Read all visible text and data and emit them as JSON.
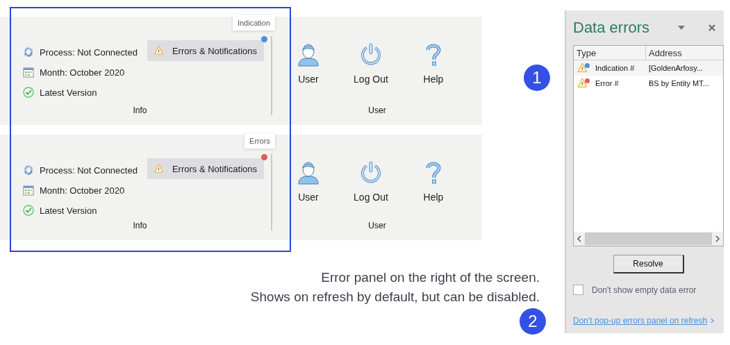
{
  "ribbons": [
    {
      "tooltip": "Indication",
      "color": "#4a90e2",
      "info_lines": [
        {
          "kind": "process",
          "text": "Process: Not Connected"
        },
        {
          "kind": "month",
          "text": "Month: October 2020"
        },
        {
          "kind": "version",
          "text": "Latest Version"
        }
      ],
      "errors_button": "Errors & Notifications",
      "info_group": "Info",
      "user_buttons": [
        {
          "kind": "user",
          "label": "User"
        },
        {
          "kind": "logout",
          "label": "Log Out"
        },
        {
          "kind": "help",
          "label": "Help"
        }
      ],
      "user_group": "User"
    },
    {
      "tooltip": "Errors",
      "color": "#e05a5a",
      "info_lines": [
        {
          "kind": "process",
          "text": "Process: Not Connected"
        },
        {
          "kind": "month",
          "text": "Month: October 2020"
        },
        {
          "kind": "version",
          "text": "Latest Version"
        }
      ],
      "errors_button": "Errors & Notifications",
      "info_group": "Info",
      "user_buttons": [
        {
          "kind": "user",
          "label": "User"
        },
        {
          "kind": "logout",
          "label": "Log Out"
        },
        {
          "kind": "help",
          "label": "Help"
        }
      ],
      "user_group": "User"
    }
  ],
  "caption": [
    "Error panel on the right of the screen.",
    "Shows on refresh by default, but can be disabled."
  ],
  "badges": [
    "1",
    "2"
  ],
  "panel": {
    "title": "Data errors",
    "columns": [
      "Type",
      "Address"
    ],
    "rows": [
      {
        "type": "Indication #",
        "address": "[GoldenArfosy...",
        "color": "#4a90e2"
      },
      {
        "type": "Error #",
        "address": "BS by Entity MT...",
        "color": "#e05a5a"
      }
    ],
    "resolve_button": "Resolve",
    "checkbox": {
      "label": "Don't show empty data error",
      "checked": false
    },
    "link": "Don't pop-up errors panel on refresh"
  }
}
